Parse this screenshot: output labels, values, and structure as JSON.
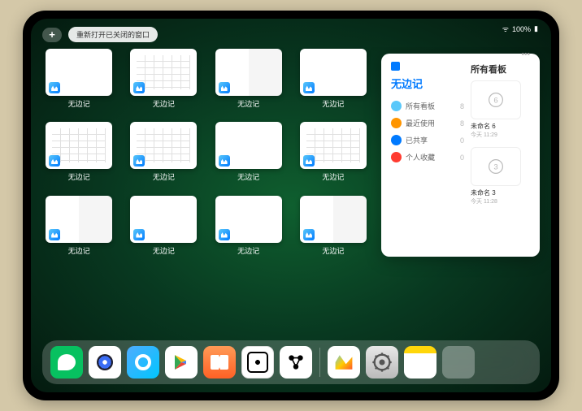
{
  "status": {
    "battery": "100%",
    "signal": "●●●"
  },
  "toolbar": {
    "add": "+",
    "reopen": "重新打开已关闭的窗口"
  },
  "app_label": "无边记",
  "windows": [
    {
      "type": "blank"
    },
    {
      "type": "cal"
    },
    {
      "type": "split"
    },
    {
      "type": "blank"
    },
    {
      "type": "cal"
    },
    {
      "type": "cal"
    },
    {
      "type": "blank"
    },
    {
      "type": "cal"
    },
    {
      "type": "split"
    },
    {
      "type": "blank"
    },
    {
      "type": "blank"
    },
    {
      "type": "split"
    }
  ],
  "panel": {
    "title": "无边记",
    "right_title": "所有看板",
    "more": "•••",
    "cats": [
      {
        "label": "所有看板",
        "count": "8",
        "cls": "ci1"
      },
      {
        "label": "最近使用",
        "count": "8",
        "cls": "ci2"
      },
      {
        "label": "已共享",
        "count": "0",
        "cls": "ci3"
      },
      {
        "label": "个人收藏",
        "count": "0",
        "cls": "ci4"
      }
    ],
    "boards": [
      {
        "num": "6",
        "label": "未命名 6",
        "sub": "今天 11:29"
      },
      {
        "num": "3",
        "label": "未命名 3",
        "sub": "今天 11:28"
      }
    ]
  },
  "dock": [
    "wechat",
    "quark",
    "q2",
    "play",
    "books",
    "dice",
    "roam",
    "freeform",
    "settings",
    "notes",
    "folder"
  ]
}
